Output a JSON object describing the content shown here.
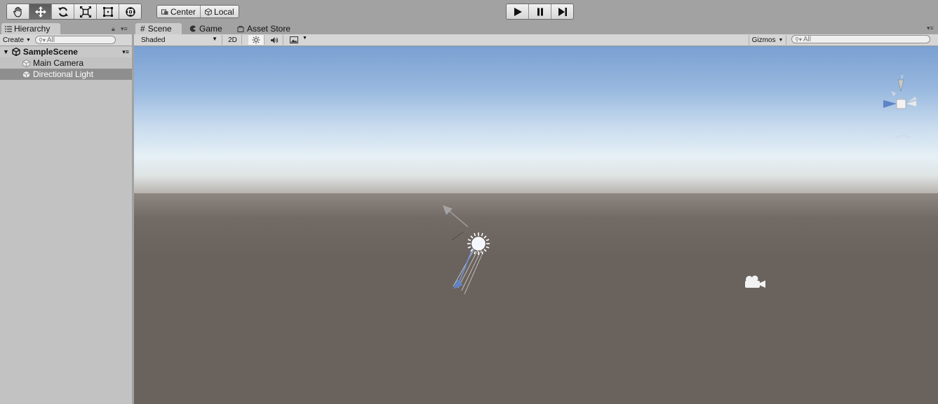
{
  "toolbar": {
    "tools": [
      {
        "name": "hand-tool",
        "icon": "hand-icon",
        "active": false
      },
      {
        "name": "move-tool",
        "icon": "move-arrows-icon",
        "active": true
      },
      {
        "name": "rotate-tool",
        "icon": "rotate-icon",
        "active": false
      },
      {
        "name": "scale-tool",
        "icon": "scale-icon",
        "active": false
      },
      {
        "name": "rect-tool",
        "icon": "rect-icon",
        "active": false
      },
      {
        "name": "transform-tool",
        "icon": "transform-icon",
        "active": false
      }
    ],
    "pivot_label": "Center",
    "space_label": "Local",
    "play_icon": "play-icon",
    "pause_icon": "pause-icon",
    "step_icon": "step-icon"
  },
  "hierarchy": {
    "tab_label": "Hierarchy",
    "create_label": "Create",
    "search_placeholder": "All",
    "scene_name": "SampleScene",
    "items": [
      {
        "label": "Main Camera",
        "selected": false
      },
      {
        "label": "Directional Light",
        "selected": true
      }
    ]
  },
  "scene_view": {
    "tabs": [
      {
        "label": "Scene",
        "active": true,
        "icon": "grid-icon"
      },
      {
        "label": "Game",
        "active": false,
        "icon": "pacman-icon"
      },
      {
        "label": "Asset Store",
        "active": false,
        "icon": "store-icon"
      }
    ],
    "shading_mode": "Shaded",
    "mode_2d_label": "2D",
    "gizmos_label": "Gizmos",
    "search_placeholder": "All",
    "colors": {
      "sky_top": "#7aa0d2",
      "ground": "#6a625d",
      "selected_row": "#8e8e8e",
      "gizmo_z_axis": "#5e84c6"
    }
  }
}
